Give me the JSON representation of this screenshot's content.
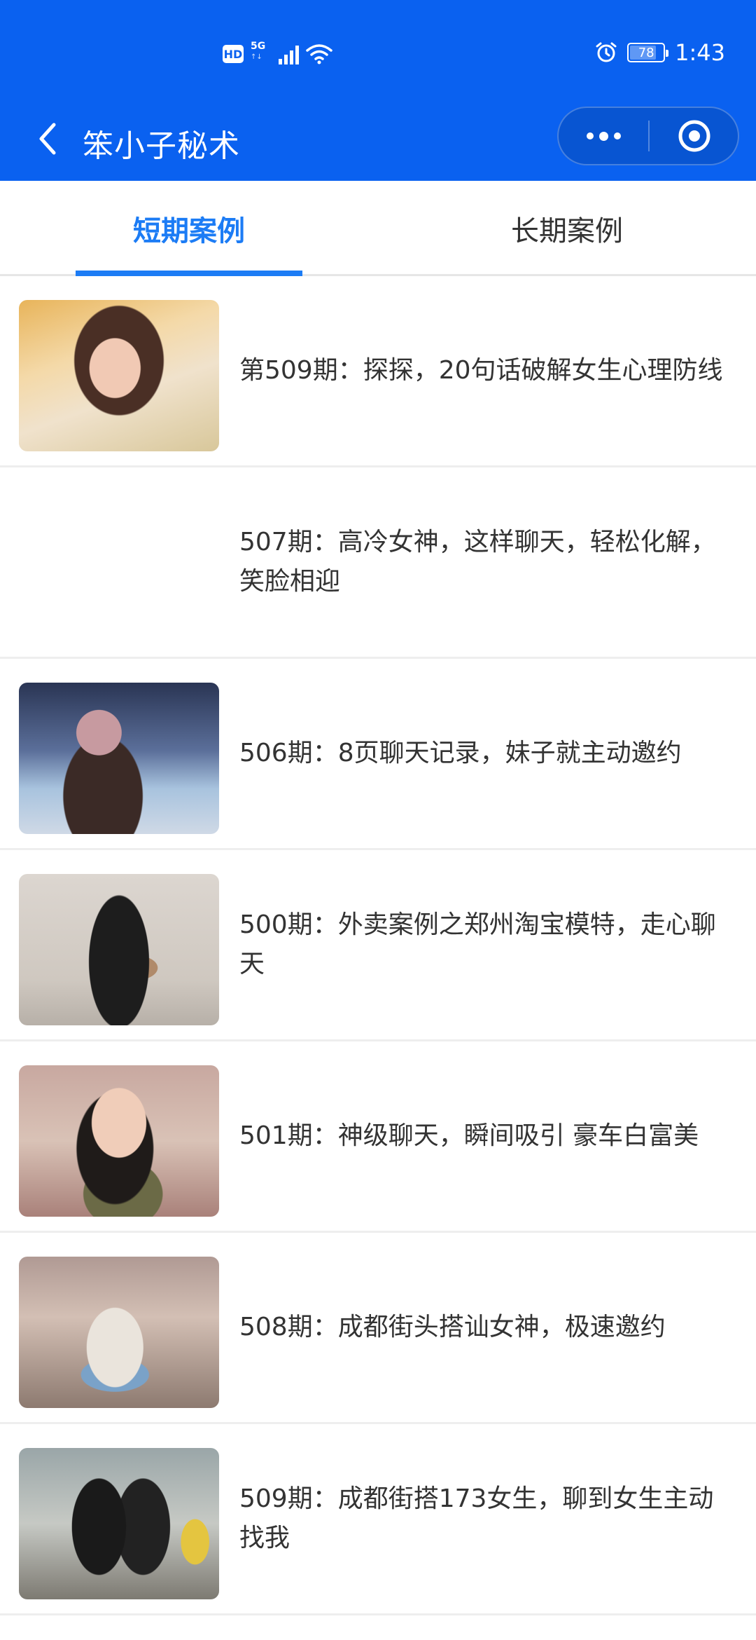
{
  "status_bar": {
    "hd": "HD",
    "network": "5G",
    "battery": "78",
    "time": "1:43"
  },
  "navbar": {
    "back_icon": "chevron-left-icon",
    "title": "笨小子秘术"
  },
  "tabs": [
    {
      "label": "短期案例",
      "active": true
    },
    {
      "label": "长期案例",
      "active": false
    }
  ],
  "cases": [
    {
      "title": "第509期：探探，20句话破解女生心理防线",
      "has_thumbnail": true
    },
    {
      "title": "507期：高冷女神，这样聊天，轻松化解，笑脸相迎",
      "has_thumbnail": false
    },
    {
      "title": "506期：8页聊天记录，妹子就主动邀约",
      "has_thumbnail": true
    },
    {
      "title": "500期：外卖案例之郑州淘宝模特，走心聊天",
      "has_thumbnail": true
    },
    {
      "title": "501期：神级聊天，瞬间吸引 豪车白富美",
      "has_thumbnail": true
    },
    {
      "title": "508期：成都街头搭讪女神，极速邀约",
      "has_thumbnail": true
    },
    {
      "title": "509期：成都街搭173女生，聊到女生主动找我",
      "has_thumbnail": true
    }
  ]
}
